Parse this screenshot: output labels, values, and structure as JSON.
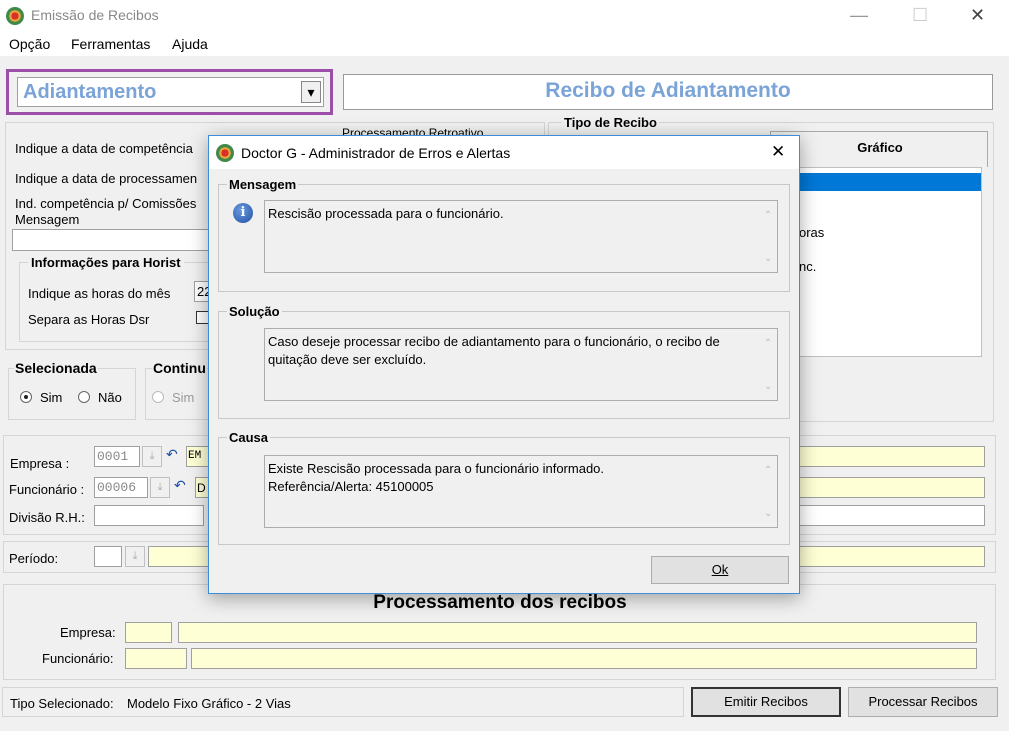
{
  "window": {
    "title": "Emissão de Recibos",
    "minimize": "—",
    "maximize": "☐",
    "close": "✕"
  },
  "menu": [
    "Opção",
    "Ferramentas",
    "Ajuda"
  ],
  "type_select": {
    "value": "Adiantamento",
    "arrow": "▾"
  },
  "banner_title": "Recibo de Adiantamento",
  "left_panel": {
    "competencia_label": "Indique a data de competência",
    "processamento_label": "Indique a data de processamen",
    "comissoes_label": "Ind. competência p/ Comissões",
    "mensagem_label": "Mensagem",
    "retroativo_label": "Processamento Retroativo",
    "horistas_title": "Informações para Horist",
    "horas_mes_label": "Indique as horas do mês",
    "horas_mes_value": "22",
    "dsr_label": "Separa as Horas Dsr"
  },
  "tipo_recibo": {
    "title": "Tipo de Recibo",
    "tab_grafico": "Gráfico",
    "list_fragments": [
      "oras",
      "nc."
    ]
  },
  "selecionada": {
    "title": "Selecionada",
    "sim": "Sim",
    "nao": "Não"
  },
  "continua": {
    "title": "Continu",
    "sim": "Sim"
  },
  "filters": {
    "empresa_label": "Empresa :",
    "empresa_value": "0001",
    "empresa_name": "EM",
    "funcionario_label": "Funcionário :",
    "funcionario_value": "00006",
    "funcionario_name": "D",
    "divisao_label": "Divisão R.H.:",
    "periodo_label": "Período:"
  },
  "processing": {
    "title": "Processamento dos recibos",
    "empresa_label": "Empresa:",
    "funcionario_label": "Funcionário:"
  },
  "status": {
    "label": "Tipo Selecionado:",
    "value": "Modelo Fixo Gráfico - 2 Vias",
    "emit_button": "Emitir Recibos",
    "process_button": "Processar Recibos"
  },
  "dialog": {
    "title": "Doctor G - Administrador de Erros e Alertas",
    "close": "✕",
    "mensagem_title": "Mensagem",
    "mensagem_text": "Rescisão processada para o funcionário.",
    "solucao_title": "Solução",
    "solucao_text": "Caso deseje processar recibo de adiantamento para o funcionário, o recibo de quitação deve ser excluído.",
    "causa_title": "Causa",
    "causa_line1": "Existe Rescisão processada para o funcionário informado.",
    "causa_line2": "Referência/Alerta: 45100005",
    "ok_button": "Ok",
    "info_icon_glyph": "i"
  }
}
